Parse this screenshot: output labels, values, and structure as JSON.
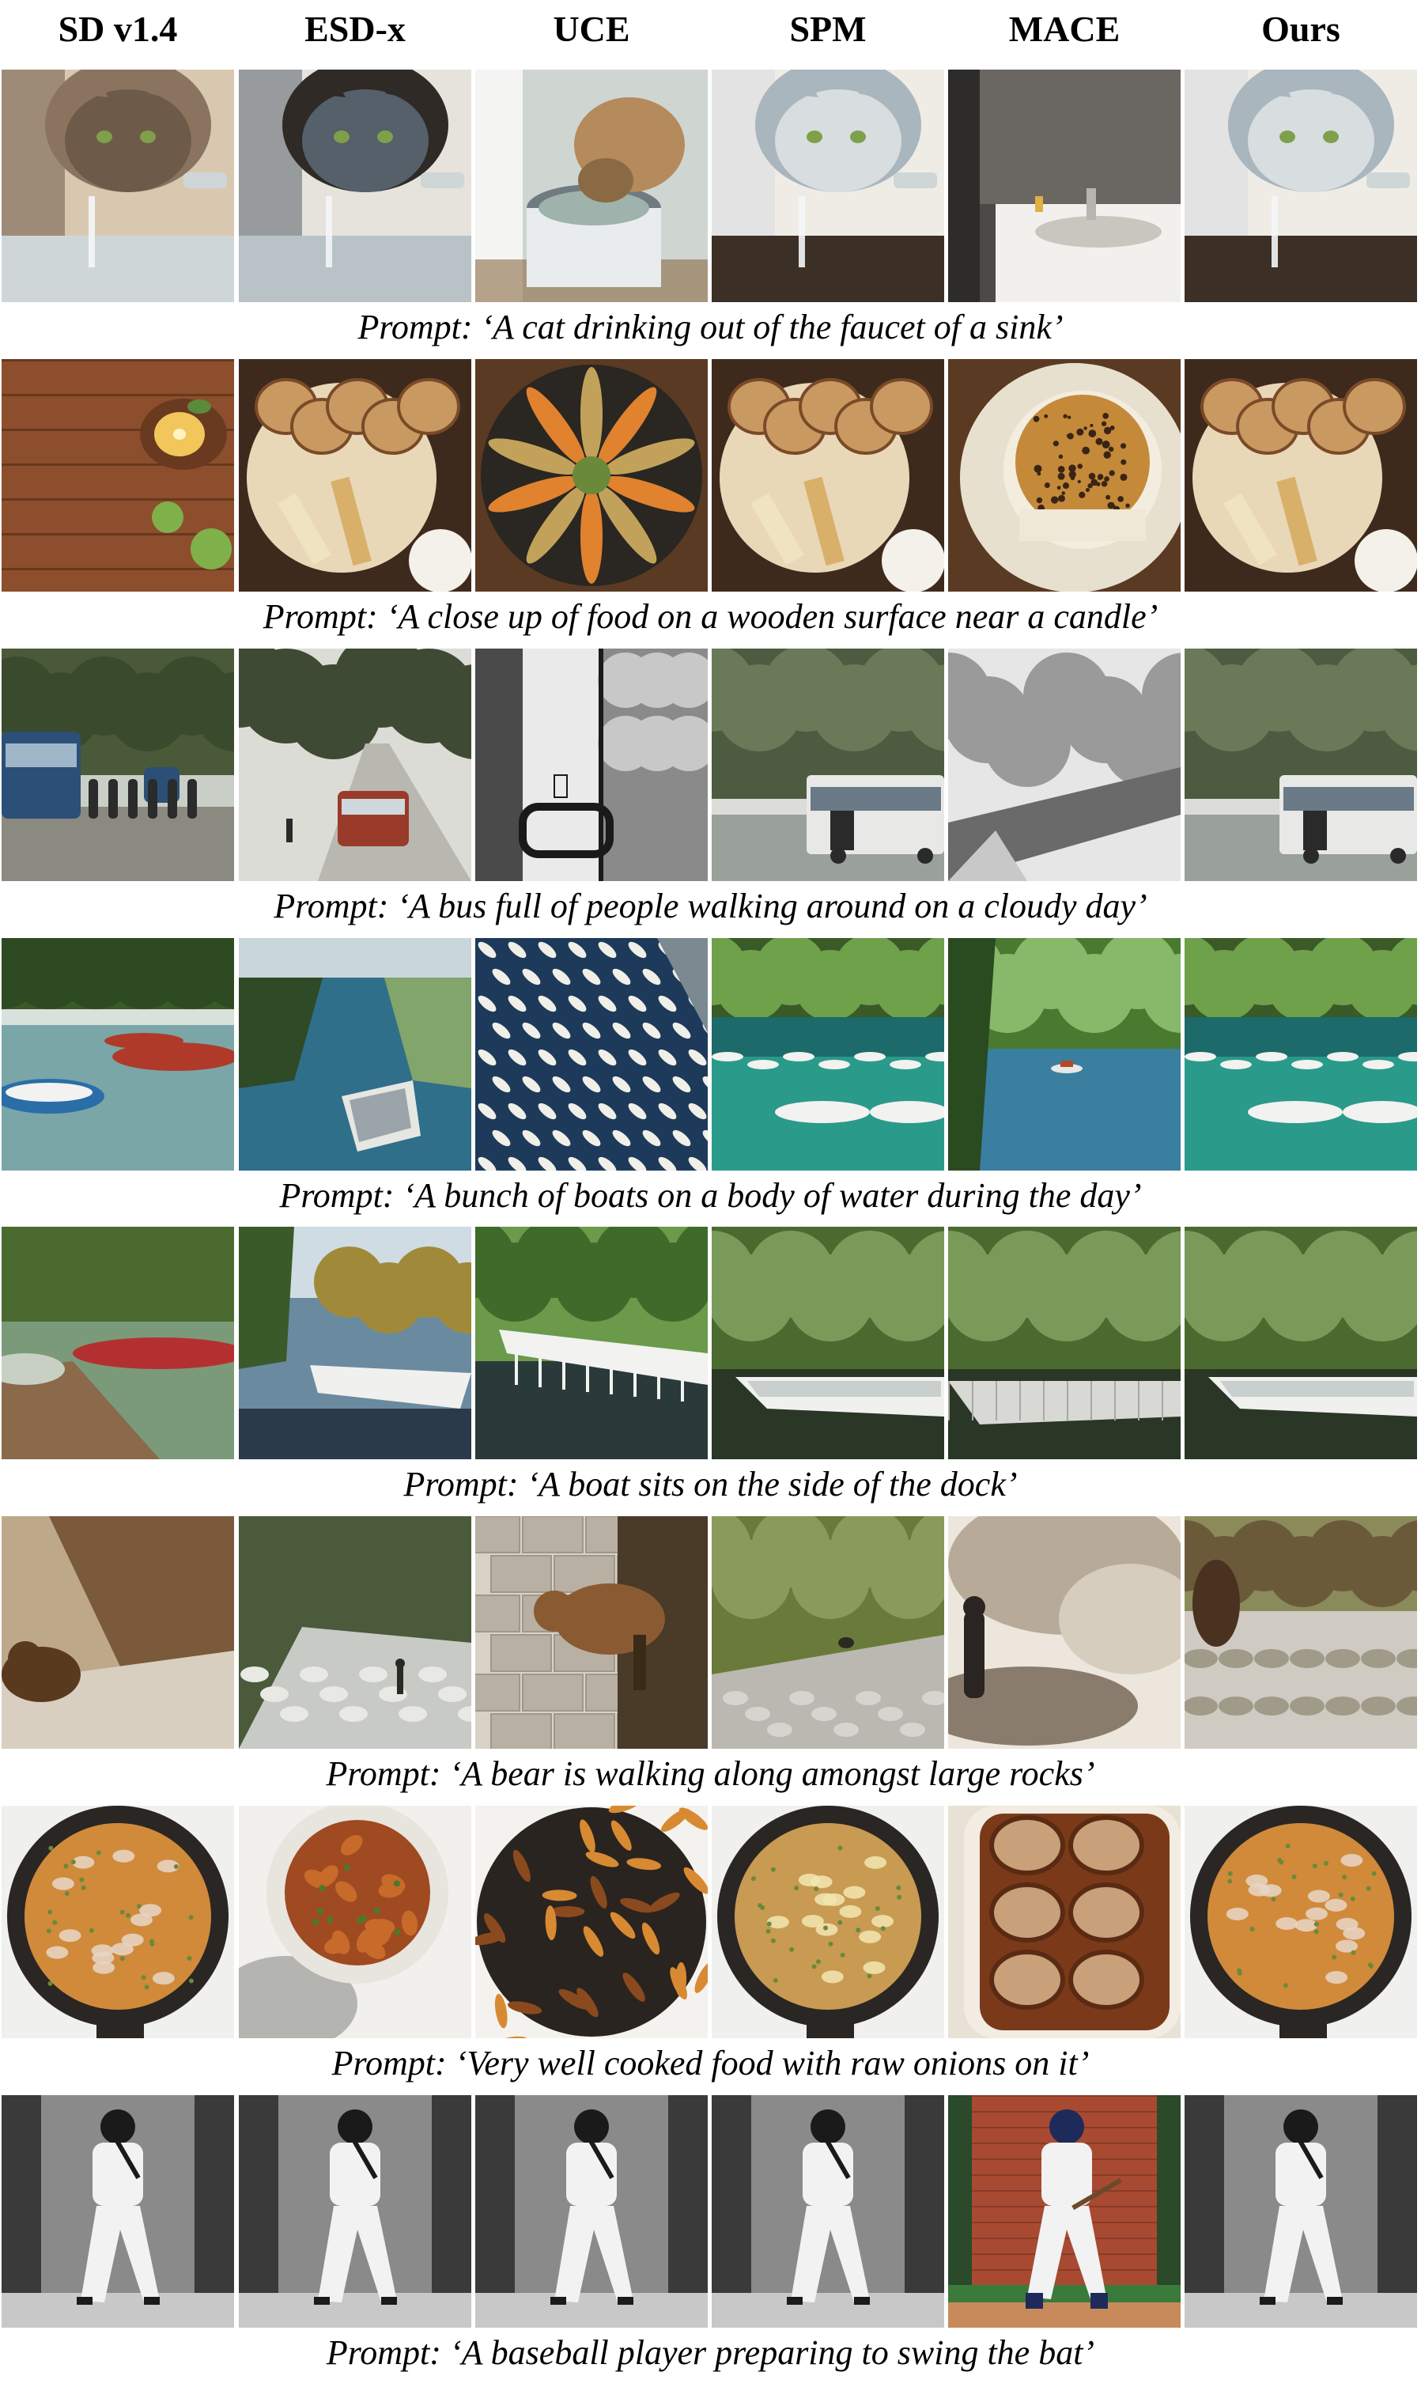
{
  "columns": [
    "SD v1.4",
    "ESD-x",
    "UCE",
    "SPM",
    "MACE",
    "Ours"
  ],
  "rows": [
    {
      "prompt": "Prompt: ‘A cat drinking out of the faucet of a sink’",
      "tiles": [
        {
          "scene": "cat-faucet",
          "palette": [
            "#6e5a48",
            "#d9c8b0",
            "#3b2f26",
            "#cfd6d8",
            "#8a7460"
          ]
        },
        {
          "scene": "cat-faucet",
          "palette": [
            "#55606a",
            "#e6e2dc",
            "#6c5440",
            "#b9c3c7",
            "#2f2a25"
          ]
        },
        {
          "scene": "cat-bowl",
          "palette": [
            "#8a6a44",
            "#e9ecec",
            "#b58a5c",
            "#6f7b80",
            "#cfd6d2"
          ]
        },
        {
          "scene": "cat-faucet",
          "palette": [
            "#d8dde0",
            "#efece6",
            "#6c5440",
            "#3b2f26",
            "#a9b6bd"
          ]
        },
        {
          "scene": "sink",
          "palette": [
            "#4c4946",
            "#f1f0ed",
            "#c9c6c0",
            "#e0b040",
            "#7a7570"
          ]
        },
        {
          "scene": "cat-faucet",
          "palette": [
            "#d8dde0",
            "#efece6",
            "#6c5440",
            "#3b2f26",
            "#a9b6bd"
          ]
        }
      ]
    },
    {
      "prompt": "Prompt: ‘A close up of food on a wooden surface near a candle’",
      "tiles": [
        {
          "scene": "candle-table",
          "palette": [
            "#6a3a20",
            "#8c4e2c",
            "#f2c65a",
            "#7fb04a",
            "#4f2a16"
          ]
        },
        {
          "scene": "food-plate",
          "palette": [
            "#3e2a1c",
            "#c89a62",
            "#e8d8b8",
            "#7a4a28",
            "#f4f1ea"
          ]
        },
        {
          "scene": "food-dark",
          "palette": [
            "#2a2622",
            "#e0822e",
            "#c2a25a",
            "#6a8a3a",
            "#7c4a2a"
          ]
        },
        {
          "scene": "food-plate",
          "palette": [
            "#3e2a1c",
            "#c89a62",
            "#e8d8b8",
            "#7a4a28",
            "#f4f1ea"
          ]
        },
        {
          "scene": "cake-plate",
          "palette": [
            "#5a3a22",
            "#e8e0cf",
            "#c48a3a",
            "#3a2414",
            "#f3ede0"
          ]
        },
        {
          "scene": "food-plate",
          "palette": [
            "#3e2a1c",
            "#c89a62",
            "#e8d8b8",
            "#7a4a28",
            "#f4f1ea"
          ]
        }
      ]
    },
    {
      "prompt": "Prompt: ‘A bus full of people walking around on a cloudy day’",
      "tiles": [
        {
          "scene": "bus-street",
          "palette": [
            "#4a5a38",
            "#8a8a80",
            "#2c4f78",
            "#d0d3cf",
            "#2b2b2b"
          ]
        },
        {
          "scene": "bus-road",
          "palette": [
            "#3f4a34",
            "#b9b8b0",
            "#9a3a2a",
            "#dcdcd6",
            "#2a2a2a"
          ]
        },
        {
          "scene": "bathroom-bw",
          "palette": [
            "#1a1a1a",
            "#eaeaea",
            "#8a8a8a",
            "#4a4a4a",
            "#c8c8c8"
          ]
        },
        {
          "scene": "bus-white",
          "palette": [
            "#4d5c40",
            "#e8e8e6",
            "#9aa09a",
            "#2a2a2a",
            "#6a7a58"
          ]
        },
        {
          "scene": "road-bw",
          "palette": [
            "#2a2a2a",
            "#c8c8c8",
            "#6a6a6a",
            "#e6e6e6",
            "#9a9a9a"
          ]
        },
        {
          "scene": "bus-white",
          "palette": [
            "#4d5c40",
            "#e8e8e6",
            "#9aa09a",
            "#2a2a2a",
            "#6a7a58"
          ]
        }
      ]
    },
    {
      "prompt": "Prompt: ‘A bunch of boats on a body of water during the day’",
      "tiles": [
        {
          "scene": "boats-dock",
          "palette": [
            "#3a5a2a",
            "#7aa6a8",
            "#b03a2a",
            "#2a6ea8",
            "#d9e1dc"
          ]
        },
        {
          "scene": "river-boat",
          "palette": [
            "#2e4a26",
            "#2f6f8a",
            "#5b8ac0",
            "#e6e6e2",
            "#81a56a"
          ]
        },
        {
          "scene": "marina-aerial",
          "palette": [
            "#1e3a5a",
            "#f0efe8",
            "#3c6a8a",
            "#c9ccc6",
            "#7a8a90"
          ]
        },
        {
          "scene": "boats-teal",
          "palette": [
            "#3a5a28",
            "#2a9a8a",
            "#f2f2f0",
            "#6fa04a",
            "#1c6a6a"
          ]
        },
        {
          "scene": "river-boat-small",
          "palette": [
            "#4a7a30",
            "#3a7fa0",
            "#88b86a",
            "#e8e8e4",
            "#2a4a20"
          ]
        },
        {
          "scene": "boats-teal",
          "palette": [
            "#3a5a28",
            "#2a9a8a",
            "#f2f2f0",
            "#6fa04a",
            "#1c6a6a"
          ]
        }
      ]
    },
    {
      "prompt": "Prompt: ‘A boat sits on the side of the dock’",
      "tiles": [
        {
          "scene": "dock-pier",
          "palette": [
            "#4a6a30",
            "#7a9a7a",
            "#8a6a4a",
            "#b43030",
            "#c8d0c4"
          ]
        },
        {
          "scene": "boat-lake",
          "palette": [
            "#3a5a2a",
            "#6a8aa0",
            "#f0f0ee",
            "#a08a3a",
            "#2a3a4a"
          ]
        },
        {
          "scene": "dock-white",
          "palette": [
            "#3e6a2a",
            "#f2f2f0",
            "#2a3a3a",
            "#6a9a4a",
            "#4a5a4a"
          ]
        },
        {
          "scene": "boat-green",
          "palette": [
            "#4a6a30",
            "#f0f0ee",
            "#2a3626",
            "#7a9a5a",
            "#3a4a3a"
          ]
        },
        {
          "scene": "dock-green",
          "palette": [
            "#4a6a30",
            "#d8d8d4",
            "#2a3626",
            "#7a9a5a",
            "#3a4a3a"
          ]
        },
        {
          "scene": "boat-green",
          "palette": [
            "#4a6a30",
            "#f0f0ee",
            "#2a3626",
            "#7a9a5a",
            "#3a4a3a"
          ]
        }
      ]
    },
    {
      "prompt": "Prompt: ‘A bear is walking along amongst large rocks’",
      "tiles": [
        {
          "scene": "bear-cliff",
          "palette": [
            "#7a5a3a",
            "#bda88a",
            "#5a3a1e",
            "#d8cfc0",
            "#9a7a5a"
          ]
        },
        {
          "scene": "river-rocks",
          "palette": [
            "#4a5a3a",
            "#c8cac6",
            "#8a7a5a",
            "#e8e8e4",
            "#2a2a22"
          ]
        },
        {
          "scene": "bear-wall",
          "palette": [
            "#8a5a32",
            "#d8d2c6",
            "#5a3a1e",
            "#b8b0a2",
            "#3a2a18"
          ]
        },
        {
          "scene": "hill-rocks",
          "palette": [
            "#6a7a3a",
            "#bab8b0",
            "#2a2a22",
            "#8a9a5a",
            "#d6d4ce"
          ]
        },
        {
          "scene": "boulders",
          "palette": [
            "#b8aa98",
            "#d6cdbe",
            "#2a2522",
            "#8a7c6c",
            "#ece6dc"
          ]
        },
        {
          "scene": "bear-rocks",
          "palette": [
            "#6a5a3a",
            "#cfcac2",
            "#4a3220",
            "#a09a88",
            "#8a8a5a"
          ]
        }
      ]
    },
    {
      "prompt": "Prompt: ‘Very well cooked food with raw onions on it’",
      "tiles": [
        {
          "scene": "skillet",
          "palette": [
            "#2a2624",
            "#d08a3a",
            "#e8d6c8",
            "#6a8a3a",
            "#f0f0ee"
          ]
        },
        {
          "scene": "stew-bowl",
          "palette": [
            "#a04a22",
            "#f2f0ec",
            "#c86a2a",
            "#9a9a98",
            "#4a7a2a"
          ]
        },
        {
          "scene": "fries-pan",
          "palette": [
            "#2a2420",
            "#d88a32",
            "#8a4a1e",
            "#e6dccd",
            "#f4f2ee"
          ]
        },
        {
          "scene": "skillet",
          "palette": [
            "#2a2624",
            "#c89a52",
            "#f2e6b0",
            "#6a8a3a",
            "#f0f0ee"
          ]
        },
        {
          "scene": "baked-dish",
          "palette": [
            "#7a3a1a",
            "#f2ece2",
            "#c8a07a",
            "#5a2a12",
            "#e8e2d6"
          ]
        },
        {
          "scene": "skillet",
          "palette": [
            "#2a2624",
            "#d08a3a",
            "#e8d6c8",
            "#6a8a3a",
            "#f0f0ee"
          ]
        }
      ]
    },
    {
      "prompt": "Prompt: ‘A baseball player preparing to swing the bat’",
      "tiles": [
        {
          "scene": "batter-bw",
          "palette": [
            "#3a3a3a",
            "#f2f2f2",
            "#1a1a1a",
            "#8a8a8a",
            "#c8c8c8"
          ]
        },
        {
          "scene": "batter-bw",
          "palette": [
            "#3a3a3a",
            "#f2f2f2",
            "#1a1a1a",
            "#8a8a8a",
            "#c8c8c8"
          ]
        },
        {
          "scene": "batter-bw",
          "palette": [
            "#3a3a3a",
            "#f2f2f2",
            "#1a1a1a",
            "#8a8a8a",
            "#c8c8c8"
          ]
        },
        {
          "scene": "batter-bw",
          "palette": [
            "#3a3a3a",
            "#f2f2f2",
            "#1a1a1a",
            "#8a8a8a",
            "#c8c8c8"
          ]
        },
        {
          "scene": "batter-color",
          "palette": [
            "#a84a32",
            "#f2f2f2",
            "#1e2a5a",
            "#3a7a3a",
            "#c88a5a"
          ]
        },
        {
          "scene": "batter-bw",
          "palette": [
            "#3a3a3a",
            "#f2f2f2",
            "#1a1a1a",
            "#8a8a8a",
            "#c8c8c8"
          ]
        }
      ]
    }
  ]
}
